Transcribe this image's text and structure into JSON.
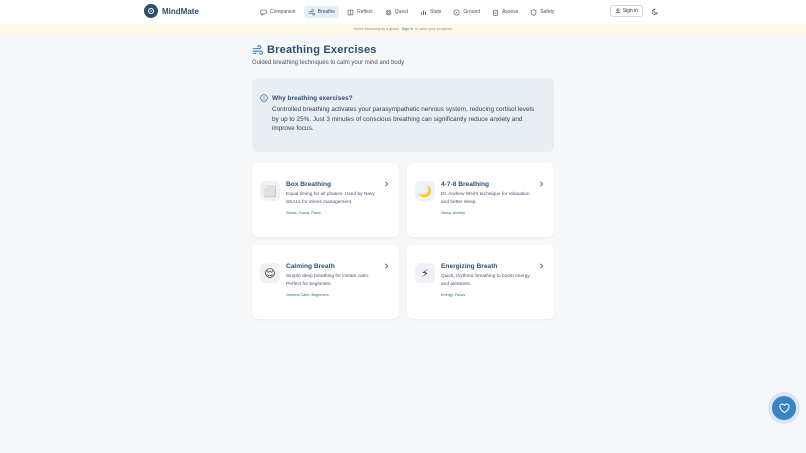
{
  "app": {
    "name": "MindMate"
  },
  "nav": {
    "items": [
      {
        "label": "Companion",
        "icon": "chat-icon"
      },
      {
        "label": "Breathe",
        "icon": "wind-icon",
        "active": true
      },
      {
        "label": "Reflect",
        "icon": "book-icon"
      },
      {
        "label": "Quest",
        "icon": "target-icon"
      },
      {
        "label": "Stats",
        "icon": "chart-icon"
      },
      {
        "label": "Ground",
        "icon": "compass-icon"
      },
      {
        "label": "Assess",
        "icon": "clipboard-icon"
      },
      {
        "label": "Safety",
        "icon": "shield-icon"
      }
    ],
    "signin_label": "Sign in"
  },
  "banner": {
    "prefix": "You're browsing as a guest.",
    "link": "Sign in",
    "suffix": "to save your progress."
  },
  "header": {
    "title": "Breathing Exercises",
    "subtitle": "Guided breathing techniques to calm your mind and body"
  },
  "info": {
    "title": "Why breathing exercises?",
    "text": "Controlled breathing activates your parasympathetic nervous system, reducing cortisol levels by up to 25%. Just 3 minutes of conscious breathing can significantly reduce anxiety and improve focus."
  },
  "exercises": [
    {
      "emoji": "⬜",
      "title": "Box Breathing",
      "description": "Equal timing for all phases. Used by Navy SEALs for stress management.",
      "tags": "Stress, Focus, Panic"
    },
    {
      "emoji": "🌙",
      "title": "4-7-8 Breathing",
      "description": "Dr. Andrew Weil's technique for relaxation and better sleep.",
      "tags": "Sleep, Anxiety"
    },
    {
      "emoji": "😌",
      "title": "Calming Breath",
      "description": "Simple deep breathing for instant calm. Perfect for beginners.",
      "tags": "General Calm, Beginners"
    },
    {
      "emoji": "⚡",
      "title": "Energizing Breath",
      "description": "Quick, rhythmic breathing to boost energy and alertness.",
      "tags": "Energy, Focus"
    }
  ],
  "colors": {
    "brand": "#2f4f6f",
    "accent": "#3a82c4",
    "tag": "#15803d",
    "banner_bg": "#fff9e8"
  }
}
